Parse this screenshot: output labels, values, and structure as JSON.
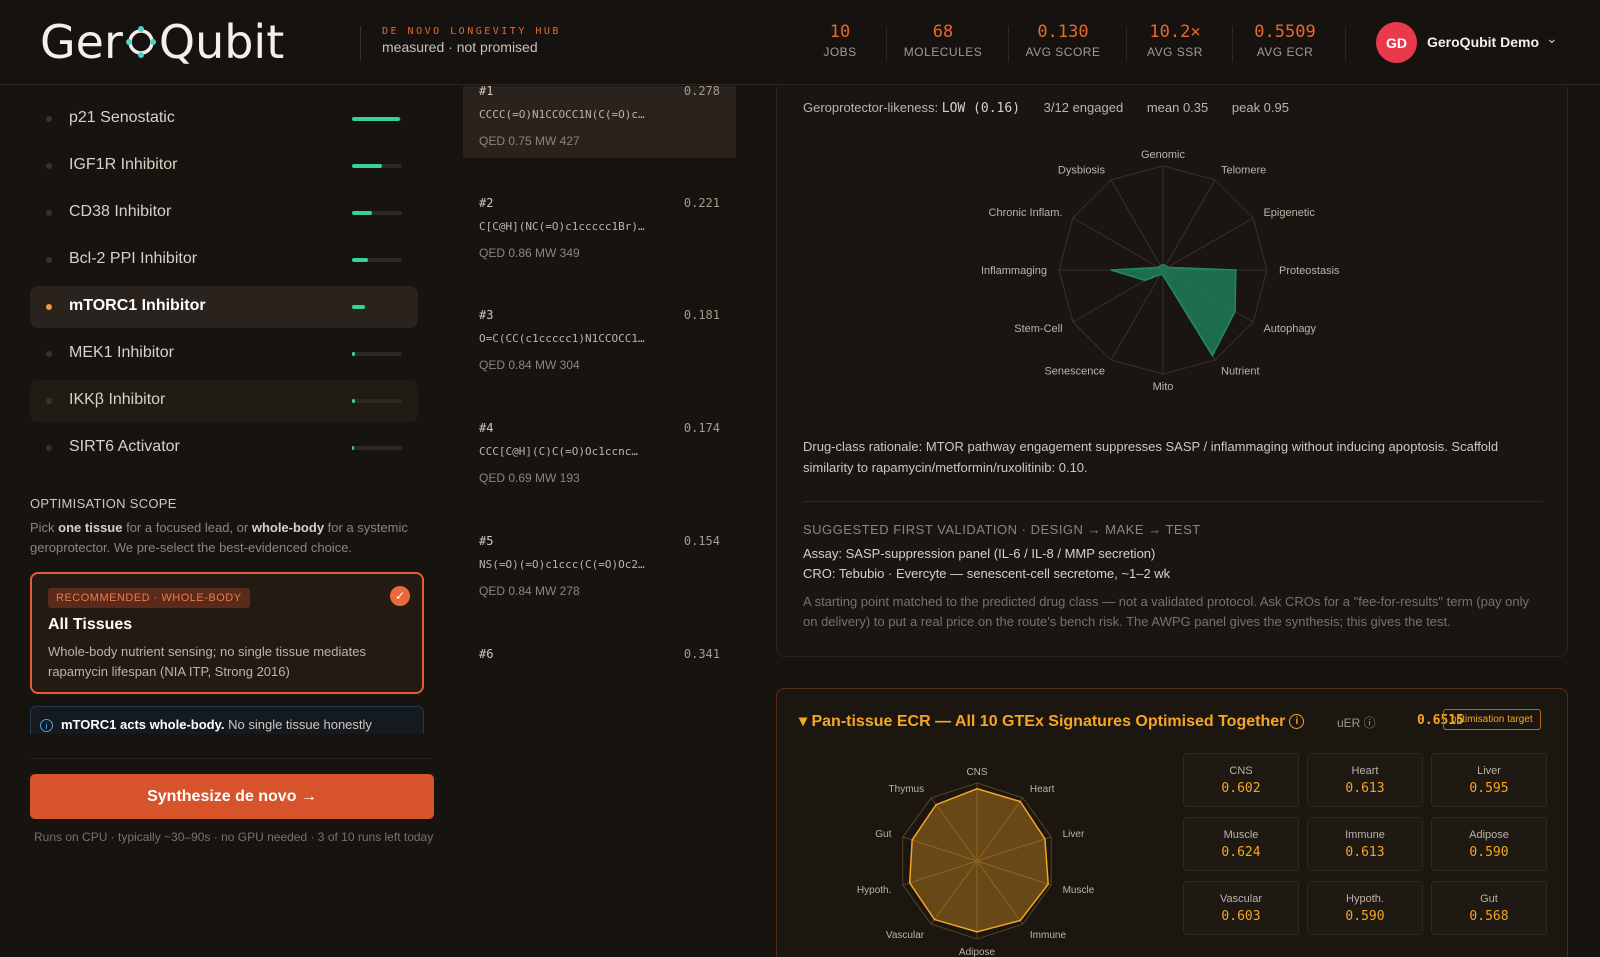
{
  "header": {
    "logo": "GeroQubit",
    "tagline_top": "DE NOVO LONGEVITY HUB",
    "tagline_bottom": "measured · not promised",
    "stats": [
      {
        "value": "10",
        "label": "JOBS"
      },
      {
        "value": "68",
        "label": "MOLECULES"
      },
      {
        "value": "0.130",
        "label": "AVG SCORE"
      },
      {
        "value": "10.2×",
        "label": "AVG SSR"
      },
      {
        "value": "0.5509",
        "label": "AVG ECR"
      }
    ],
    "user": {
      "initials": "GD",
      "name": "GeroQubit Demo"
    }
  },
  "targets": [
    {
      "label": "p21 Senostatic",
      "fill": 0.95
    },
    {
      "label": "IGF1R Inhibitor",
      "fill": 0.6
    },
    {
      "label": "CD38 Inhibitor",
      "fill": 0.4
    },
    {
      "label": "Bcl-2 PPI Inhibitor",
      "fill": 0.32
    },
    {
      "label": "mTORC1 Inhibitor",
      "fill": 0.26,
      "active": true
    },
    {
      "label": "MEK1 Inhibitor",
      "fill": 0.05
    },
    {
      "label": "IKKβ Inhibitor",
      "fill": 0.05
    },
    {
      "label": "SIRT6 Activator",
      "fill": 0.03
    }
  ],
  "scope": {
    "title": "OPTIMISATION SCOPE",
    "text_pre": "Pick ",
    "text_b1": "one tissue",
    "text_mid": " for a focused lead, or ",
    "text_b2": "whole-body",
    "text_post": " for a systemic geroprotector. We pre-select the best-evidenced choice.",
    "rec_badge": "RECOMMENDED · WHOLE-BODY",
    "rec_title": "All Tissues",
    "rec_desc": "Whole-body nutrient sensing; no single tissue mediates rapamycin lifespan (NIA ITP, Strong 2016)",
    "info_bold": "mTORC1 acts whole-body.",
    "info_text": " No single tissue honestly",
    "button": "Synthesize de novo →",
    "runs_note": "Runs on CPU · typically ~30–90s · no GPU needed · 3 of 10 runs left today"
  },
  "molecules": [
    {
      "rank": "#1",
      "score": "0.278",
      "smiles": "CCCC(=O)N1CCOCC1N(C(=O)c…",
      "meta": "QED 0.75   MW 427"
    },
    {
      "rank": "#2",
      "score": "0.221",
      "smiles": "C[C@H](NC(=O)c1ccccc1Br)…",
      "meta": "QED 0.86   MW 349"
    },
    {
      "rank": "#3",
      "score": "0.181",
      "smiles": "O=C(CC(c1ccccc1)N1CCOCC1…",
      "meta": "QED 0.84   MW 304"
    },
    {
      "rank": "#4",
      "score": "0.174",
      "smiles": "CCC[C@H](C)C(=O)Oc1ccnc…",
      "meta": "QED 0.69   MW 193"
    },
    {
      "rank": "#5",
      "score": "0.154",
      "smiles": "NS(=O)(=O)c1ccc(C(=O)Oc2…",
      "meta": "QED 0.84   MW 278"
    },
    {
      "rank": "#6",
      "score": "0.341",
      "smiles": "",
      "meta": ""
    }
  ],
  "geroprotector": {
    "label": "Geroprotector-likeness:",
    "value": "LOW (0.16)",
    "engaged": "3/12 engaged",
    "mean": "mean 0.35",
    "peak": "peak 0.95",
    "axes": [
      "Genomic",
      "Telomere",
      "Epigenetic",
      "Proteostasis",
      "Autophagy",
      "Nutrient",
      "Mito",
      "Senescence",
      "Stem-Cell",
      "Inflammaging",
      "Chronic Inflam.",
      "Dysbiosis"
    ],
    "values": [
      0.05,
      0.05,
      0.05,
      0.7,
      0.8,
      0.95,
      0.05,
      0.05,
      0.2,
      0.5,
      0.05,
      0.05
    ],
    "color": "#1f8a62"
  },
  "rationale": "Drug-class rationale: MTOR pathway engagement suppresses SASP / inflammaging without inducing apoptosis. Scaffold similarity to rapamycin/metformin/ruxolitinib: 0.10.",
  "validation": {
    "title": "SUGGESTED FIRST VALIDATION · DESIGN → MAKE → TEST",
    "assay": "Assay: SASP-suppression panel (IL-6 / IL-8 / MMP secretion)",
    "cro": "CRO: Tebubio · Evercyte — senescent-cell secretome, ~1–2 wk",
    "note": "A starting point matched to the predicted drug class — not a validated protocol. Ask CROs for a \"fee-for-results\" term (pay only on delivery) to put a real price on the route's bench risk. The AWPG panel gives the synthesis; this gives the test."
  },
  "ecr": {
    "title": "▾ Pan-tissue ECR — All 10 GTEx Signatures Optimised Together",
    "uer_label": "uER ⓘ",
    "uer_value": "0.6515",
    "tag": "optimisation target",
    "axes": [
      "CNS",
      "Heart",
      "Liver",
      "Muscle",
      "Immune",
      "Adipose",
      "Vascular",
      "Hypoth.",
      "Gut",
      "Thymus"
    ],
    "values": [
      0.602,
      0.613,
      0.595,
      0.624,
      0.613,
      0.59,
      0.603,
      0.59,
      0.568,
      0.58
    ],
    "color": "#f5a623",
    "tissues": [
      {
        "name": "CNS",
        "score": "0.602"
      },
      {
        "name": "Heart",
        "score": "0.613"
      },
      {
        "name": "Liver",
        "score": "0.595"
      },
      {
        "name": "Muscle",
        "score": "0.624"
      },
      {
        "name": "Immune",
        "score": "0.613"
      },
      {
        "name": "Adipose",
        "score": "0.590"
      },
      {
        "name": "Vascular",
        "score": "0.603"
      },
      {
        "name": "Hypoth.",
        "score": "0.590"
      },
      {
        "name": "Gut",
        "score": "0.568"
      }
    ]
  }
}
